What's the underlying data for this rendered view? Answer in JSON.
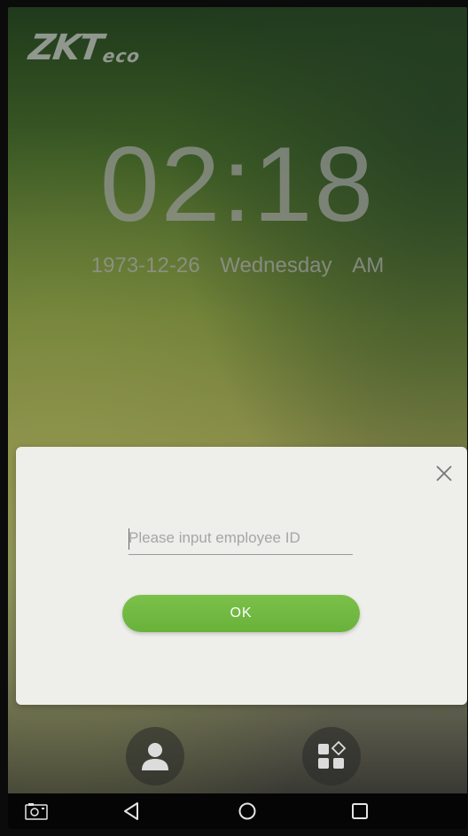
{
  "logo": {
    "main": "ZKT",
    "sub": "eco"
  },
  "clock": {
    "time": "02:18",
    "date": "1973-12-26",
    "weekday": "Wednesday",
    "meridiem": "AM"
  },
  "dialog": {
    "input_value": "",
    "input_placeholder": "Please input employee ID",
    "ok_label": "OK"
  },
  "icons": {
    "close": "close-icon",
    "user": "user-icon",
    "menu": "app-menu-icon",
    "camera": "screenshot-icon",
    "back": "back-icon",
    "home": "home-icon",
    "recent": "recent-apps-icon"
  },
  "colors": {
    "accent": "#6cb43d",
    "dialog_bg": "#eeeeea",
    "nav_bg": "#050505"
  }
}
